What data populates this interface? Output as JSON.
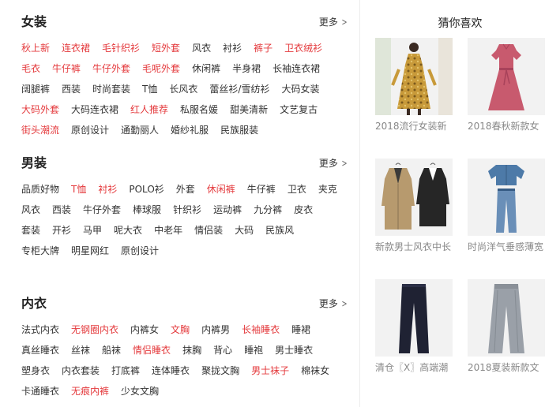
{
  "sections": [
    {
      "title": "女装",
      "more": "更多",
      "rows": [
        [
          {
            "label": "秋上新",
            "hot": true
          },
          {
            "label": "连衣裙",
            "hot": true
          },
          {
            "label": "毛针织衫",
            "hot": true
          },
          {
            "label": "短外套",
            "hot": true
          },
          {
            "label": "风衣",
            "hot": false
          },
          {
            "label": "衬衫",
            "hot": false
          },
          {
            "label": "裤子",
            "hot": true
          },
          {
            "label": "卫衣绒衫",
            "hot": true
          }
        ],
        [
          {
            "label": "毛衣",
            "hot": true
          },
          {
            "label": "牛仔裤",
            "hot": true
          },
          {
            "label": "牛仔外套",
            "hot": true
          },
          {
            "label": "毛呢外套",
            "hot": true
          },
          {
            "label": "休闲裤",
            "hot": false
          },
          {
            "label": "半身裙",
            "hot": false
          },
          {
            "label": "长袖连衣裙",
            "hot": false
          }
        ],
        [
          {
            "label": "阔腿裤",
            "hot": false
          },
          {
            "label": "西装",
            "hot": false
          },
          {
            "label": "时尚套装",
            "hot": false
          },
          {
            "label": "T恤",
            "hot": false
          },
          {
            "label": "长风衣",
            "hot": false
          },
          {
            "label": "蕾丝衫/雪纺衫",
            "hot": false
          },
          {
            "label": "大码女装",
            "hot": false
          }
        ],
        [
          {
            "label": "大码外套",
            "hot": true
          },
          {
            "label": "大码连衣裙",
            "hot": false
          },
          {
            "label": "红人推荐",
            "hot": true
          },
          {
            "label": "私服名媛",
            "hot": false
          },
          {
            "label": "甜美清新",
            "hot": false
          },
          {
            "label": "文艺复古",
            "hot": false
          }
        ],
        [
          {
            "label": "街头潮流",
            "hot": true
          },
          {
            "label": "原创设计",
            "hot": false
          },
          {
            "label": "通勤丽人",
            "hot": false
          },
          {
            "label": "婚纱礼服",
            "hot": false
          },
          {
            "label": "民族服装",
            "hot": false
          }
        ]
      ]
    },
    {
      "title": "男装",
      "more": "更多",
      "rows": [
        [
          {
            "label": "品质好物",
            "hot": false
          },
          {
            "label": "T恤",
            "hot": true
          },
          {
            "label": "衬衫",
            "hot": true
          },
          {
            "label": "POLO衫",
            "hot": false
          },
          {
            "label": "外套",
            "hot": false
          },
          {
            "label": "休闲裤",
            "hot": true
          },
          {
            "label": "牛仔裤",
            "hot": false
          },
          {
            "label": "卫衣",
            "hot": false
          },
          {
            "label": "夹克",
            "hot": false
          }
        ],
        [
          {
            "label": "风衣",
            "hot": false
          },
          {
            "label": "西装",
            "hot": false
          },
          {
            "label": "牛仔外套",
            "hot": false
          },
          {
            "label": "棒球服",
            "hot": false
          },
          {
            "label": "针织衫",
            "hot": false
          },
          {
            "label": "运动裤",
            "hot": false
          },
          {
            "label": "九分裤",
            "hot": false
          },
          {
            "label": "皮衣",
            "hot": false
          }
        ],
        [
          {
            "label": "套装",
            "hot": false
          },
          {
            "label": "开衫",
            "hot": false
          },
          {
            "label": "马甲",
            "hot": false
          },
          {
            "label": "呢大衣",
            "hot": false
          },
          {
            "label": "中老年",
            "hot": false
          },
          {
            "label": "情侣装",
            "hot": false
          },
          {
            "label": "大码",
            "hot": false
          },
          {
            "label": "民族风",
            "hot": false
          }
        ],
        [
          {
            "label": "专柜大牌",
            "hot": false
          },
          {
            "label": "明星网红",
            "hot": false
          },
          {
            "label": "原创设计",
            "hot": false
          }
        ]
      ]
    },
    {
      "title": "内衣",
      "more": "更多",
      "rows": [
        [
          {
            "label": "法式内衣",
            "hot": false
          },
          {
            "label": "无钢圈内衣",
            "hot": true
          },
          {
            "label": "内裤女",
            "hot": false
          },
          {
            "label": "文胸",
            "hot": true
          },
          {
            "label": "内裤男",
            "hot": false
          },
          {
            "label": "长袖睡衣",
            "hot": true
          },
          {
            "label": "睡裙",
            "hot": false
          }
        ],
        [
          {
            "label": "真丝睡衣",
            "hot": false
          },
          {
            "label": "丝袜",
            "hot": false
          },
          {
            "label": "船袜",
            "hot": false
          },
          {
            "label": "情侣睡衣",
            "hot": true
          },
          {
            "label": "抹胸",
            "hot": false
          },
          {
            "label": "背心",
            "hot": false
          },
          {
            "label": "睡袍",
            "hot": false
          },
          {
            "label": "男士睡衣",
            "hot": false
          }
        ],
        [
          {
            "label": "塑身衣",
            "hot": false
          },
          {
            "label": "内衣套装",
            "hot": false
          },
          {
            "label": "打底裤",
            "hot": false
          },
          {
            "label": "连体睡衣",
            "hot": false
          },
          {
            "label": "聚拢文胸",
            "hot": false
          },
          {
            "label": "男士袜子",
            "hot": true
          },
          {
            "label": "棉袜女",
            "hot": false
          }
        ],
        [
          {
            "label": "卡通睡衣",
            "hot": false
          },
          {
            "label": "无痕内裤",
            "hot": true
          },
          {
            "label": "少女文胸",
            "hot": false
          }
        ]
      ]
    }
  ],
  "recommend": {
    "title": "猜你喜欢",
    "items": [
      {
        "caption": "2018流行女装新",
        "image": "floral-dress-image"
      },
      {
        "caption": "2018春秋新款女",
        "image": "pink-dress-image"
      },
      {
        "caption": "新款男士风衣中长",
        "image": "trench-coats-image"
      },
      {
        "caption": "时尚洋气垂感薄宽",
        "image": "denim-set-image"
      },
      {
        "caption": "清仓〖X〗高端潮",
        "image": "black-trousers-image"
      },
      {
        "caption": "2018夏装新款文",
        "image": "grey-pants-image"
      }
    ]
  },
  "colors": {
    "accent": "#e4393c",
    "text": "#333333",
    "caption": "#888888"
  }
}
